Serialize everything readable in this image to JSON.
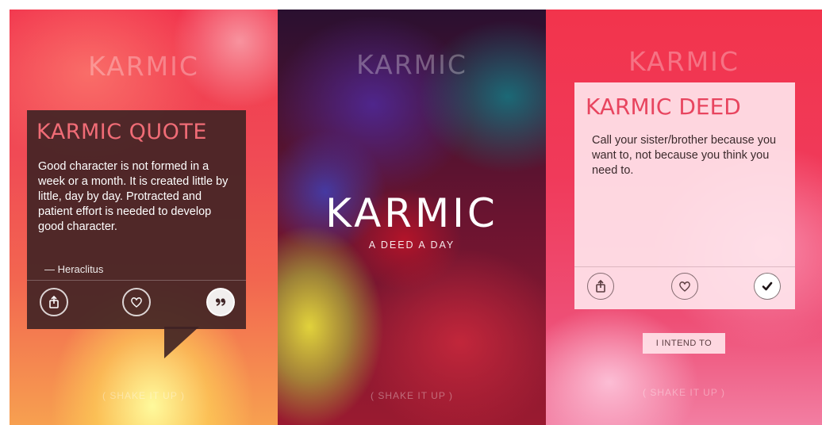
{
  "screens": {
    "quote": {
      "logo": "KARMIC",
      "card_title": "KARMIC QUOTE",
      "quote_text": "Good character is not formed in a week or a month. It is created little by little, day by day. Protracted and patient effort is needed to develop good character.",
      "author": "— Heraclitus",
      "actions": [
        "share-icon",
        "heart-icon",
        "quote-icon"
      ],
      "hint": "( SHAKE IT UP )"
    },
    "splash": {
      "logo_faint": "KARMIC",
      "logo": "KARMIC",
      "tagline": "A DEED A DAY",
      "hint": "( SHAKE IT UP )"
    },
    "deed": {
      "logo": "KARMIC",
      "card_title": "KARMIC DEED",
      "deed_text": "Call your sister/brother because you want to, not because you think you need to.",
      "actions": [
        "share-icon",
        "heart-icon",
        "check-icon"
      ],
      "button_label": "I INTEND TO",
      "hint": "( SHAKE IT UP )"
    }
  },
  "colors": {
    "accent_pink": "#f06c76",
    "deed_title": "#e8455f",
    "quote_card_bg": "#3e2224"
  }
}
